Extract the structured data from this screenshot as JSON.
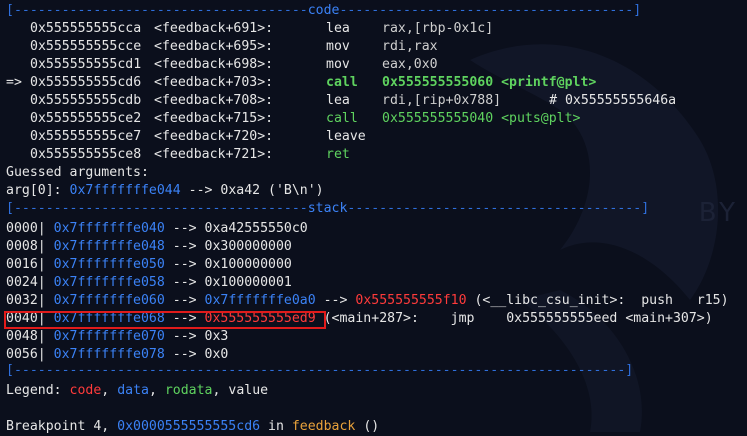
{
  "code_header": {
    "left": "[",
    "rule_left": "-------------------------------------",
    "title": "code",
    "rule_right": "-------------------------------------",
    "right": "]"
  },
  "code_lines": [
    {
      "marker": "",
      "addr": "0x555555555cca",
      "sym": "<feedback+691>:",
      "op": "lea",
      "args": "rax,[rbp-0x1c]"
    },
    {
      "marker": "",
      "addr": "0x555555555cce",
      "sym": "<feedback+695>:",
      "op": "mov",
      "args": "rdi,rax"
    },
    {
      "marker": "",
      "addr": "0x555555555cd1",
      "sym": "<feedback+698>:",
      "op": "mov",
      "args": "eax,0x0"
    },
    {
      "marker": "=>",
      "addr": "0x555555555cd6",
      "sym": "<feedback+703>:",
      "op": "call",
      "args": "0x555555555060 <printf@plt>"
    },
    {
      "marker": "",
      "addr": "0x555555555cdb",
      "sym": "<feedback+708>:",
      "op": "lea",
      "args": "rdi,[rip+0x788]",
      "comment": "# 0x55555555646a"
    },
    {
      "marker": "",
      "addr": "0x555555555ce2",
      "sym": "<feedback+715>:",
      "op": "call",
      "args": "0x555555555040 <puts@plt>"
    },
    {
      "marker": "",
      "addr": "0x555555555ce7",
      "sym": "<feedback+720>:",
      "op": "leave",
      "args": ""
    },
    {
      "marker": "",
      "addr": "0x555555555ce8",
      "sym": "<feedback+721>:",
      "op": "ret",
      "args": ""
    }
  ],
  "guessed": {
    "title": "Guessed arguments:",
    "arg_label": "arg[0]: ",
    "arg_addr": "0x7fffffffe044",
    "arg_rest": " --> 0xa42 ('B\\n')"
  },
  "stack_header": {
    "title": "stack"
  },
  "stack_lines": [
    {
      "off": "0000|",
      "addr": "0x7fffffffe040",
      "arrow": " --> ",
      "val": "0xa42555550c0",
      "extra": ""
    },
    {
      "off": "0008|",
      "addr": "0x7fffffffe048",
      "arrow": " --> ",
      "val": "0x300000000",
      "extra": ""
    },
    {
      "off": "0016|",
      "addr": "0x7fffffffe050",
      "arrow": " --> ",
      "val": "0x100000000",
      "extra": ""
    },
    {
      "off": "0024|",
      "addr": "0x7fffffffe058",
      "arrow": " --> ",
      "val": "0x100000001",
      "extra": ""
    },
    {
      "off": "0032|",
      "addr": "0x7fffffffe060",
      "arrow": " --> ",
      "val": "0x7fffffffe0a0",
      "extra": " --> ",
      "val2": "0x555555555f10",
      "tail": " (<__libc_csu_init>:  push   r15)"
    },
    {
      "off": "0040|",
      "addr": "0x7fffffffe068",
      "arrow": " --> ",
      "val": "0x555555555ed9",
      "tail": " (<main+287>:    jmp    0x555555555eed <main+307>)"
    },
    {
      "off": "0048|",
      "addr": "0x7fffffffe070",
      "arrow": " --> ",
      "val": "0x3",
      "extra": ""
    },
    {
      "off": "0056|",
      "addr": "0x7fffffffe078",
      "arrow": " --> ",
      "val": "0x0",
      "extra": ""
    }
  ],
  "legend": {
    "label": "Legend: ",
    "code": "code",
    "data": "data",
    "rodata": "rodata",
    "value": "value"
  },
  "breakpoint": {
    "prefix": "Breakpoint 4, ",
    "addr": "0x0000555555555cd6",
    "in": " in ",
    "func": "feedback",
    "suffix": " ()"
  },
  "watermark": "BY",
  "colors": {
    "background": "#0b0f1c",
    "separator": "#2f6fdb",
    "address": "#3b82f6",
    "code": "#ff3b3b",
    "call": "#5fd35f",
    "highlight": "#e01b1b"
  }
}
